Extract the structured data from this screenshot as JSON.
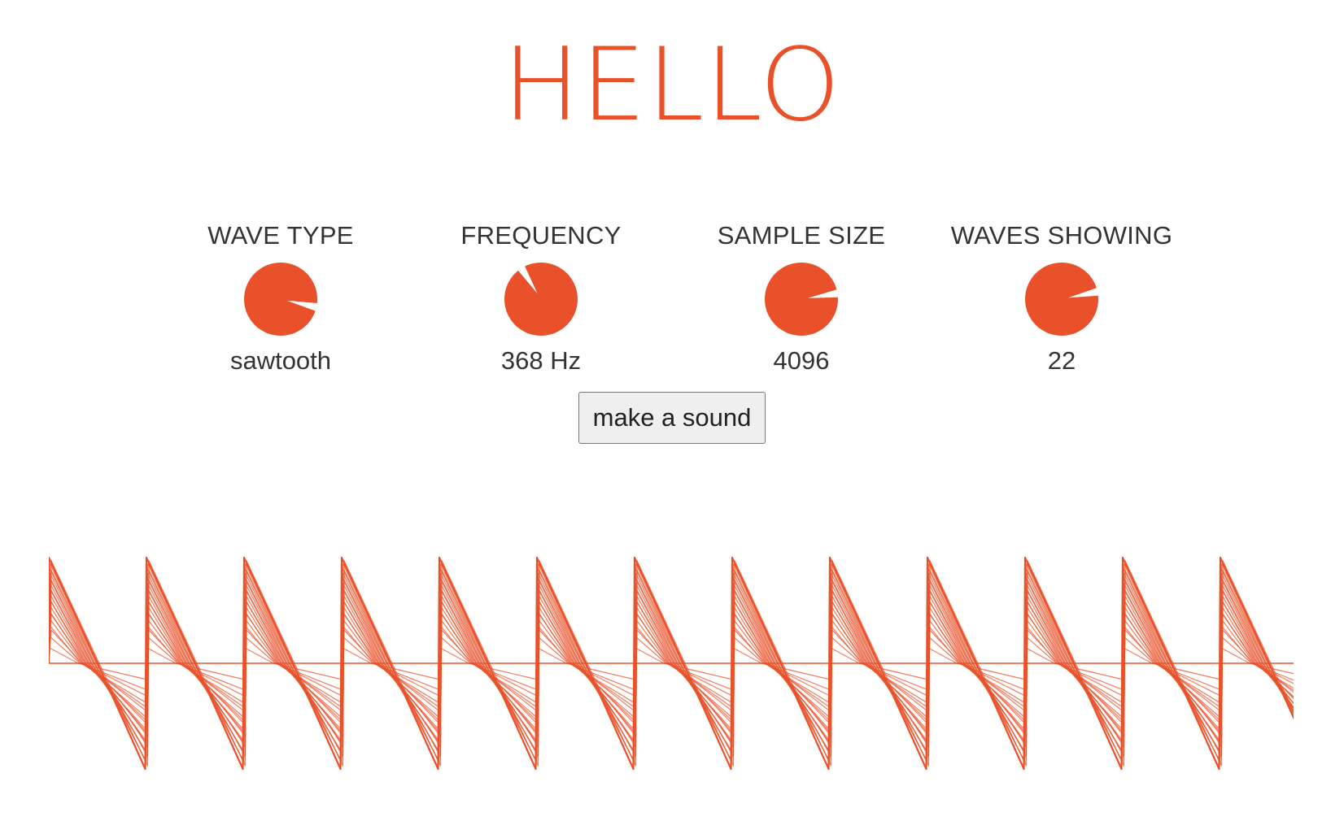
{
  "header": {
    "title": "HELLO"
  },
  "controls": [
    {
      "label": "WAVE TYPE",
      "value": "sawtooth",
      "level": 0.88
    },
    {
      "label": "FREQUENCY",
      "value": "368 Hz",
      "level": 0.38
    },
    {
      "label": "SAMPLE SIZE",
      "value": "4096",
      "level": 0.8
    },
    {
      "label": "WAVES SHOWING",
      "value": "22",
      "level": 0.79
    }
  ],
  "button": {
    "label": "make a sound"
  },
  "waveform": {
    "type": "sawtooth",
    "cycles_visible": 13,
    "overlay_count": 22
  },
  "colors": {
    "accent": "#e8512a",
    "text": "#333333",
    "button_bg": "#efefef",
    "button_border": "#767676"
  },
  "icons": {
    "knob": "dial-knob"
  }
}
